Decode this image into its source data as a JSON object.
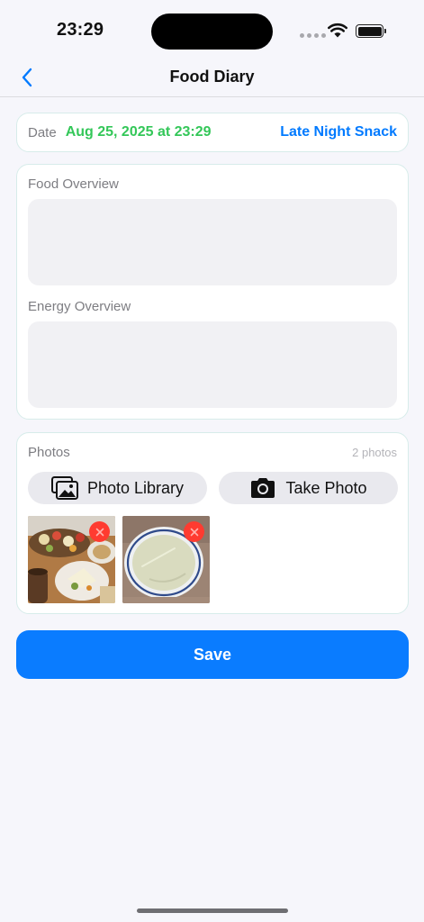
{
  "status_bar": {
    "time": "23:29"
  },
  "nav": {
    "title": "Food Diary"
  },
  "date_row": {
    "label": "Date",
    "value": "Aug 25, 2025 at 23:29",
    "meal_type": "Late Night Snack"
  },
  "overview": {
    "food_label": "Food Overview",
    "food_value": "",
    "energy_label": "Energy Overview",
    "energy_value": ""
  },
  "photos": {
    "label": "Photos",
    "count": "2 photos",
    "library_label": "Photo Library",
    "camera_label": "Take Photo",
    "thumbnails": [
      "food-platter-photo",
      "white-soup-bowl-photo"
    ]
  },
  "save_label": "Save",
  "colors": {
    "accent": "#007aff",
    "save": "#0a7cff",
    "date_green": "#34c759",
    "delete_red": "#ff3b30",
    "card_border": "#d7ecea",
    "background": "#f6f6fb"
  },
  "icons": {
    "back": "chevron-left-icon",
    "library": "photo-library-icon",
    "camera": "camera-icon",
    "delete": "delete-x-icon"
  }
}
